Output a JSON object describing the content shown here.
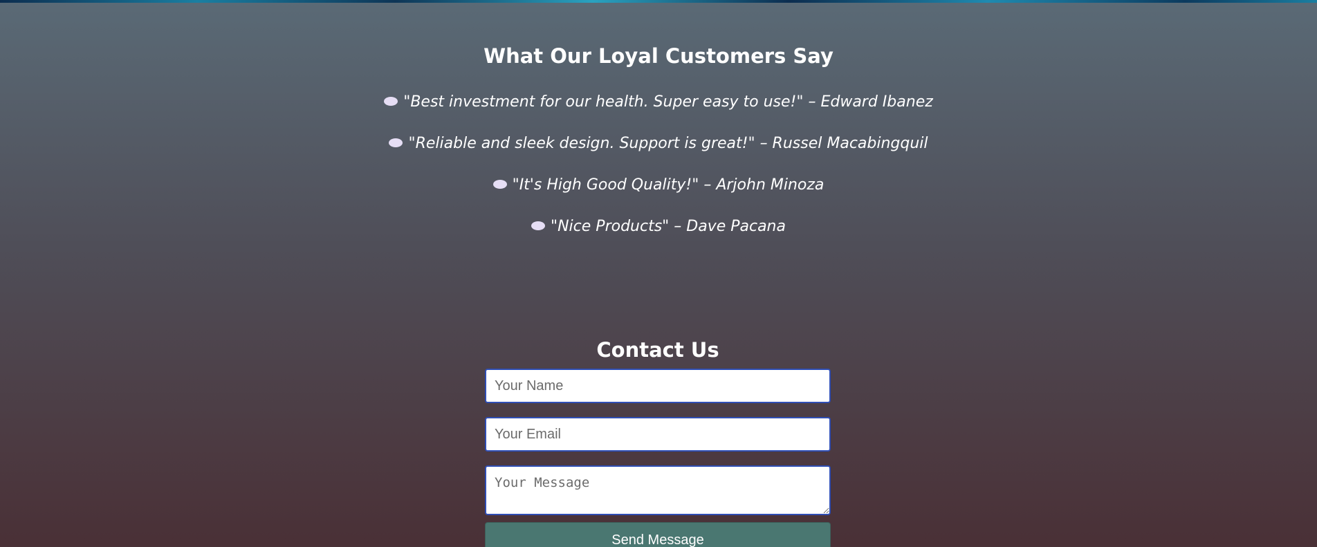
{
  "testimonials": {
    "title": "What Our Loyal Customers Say",
    "bubble_color": "#e6def5",
    "items": [
      {
        "text": "\"Best investment for our health. Super easy to use!\" – Edward Ibanez",
        "icon": "speech-bubble-icon"
      },
      {
        "text": "\"Reliable and sleek design. Support is great!\" – Russel Macabingquil",
        "icon": "speech-bubble-icon"
      },
      {
        "text": "\"It's High Good Quality!\" – Arjohn Minoza",
        "icon": "speech-bubble-icon"
      },
      {
        "text": "\"Nice Products\" – Dave Pacana",
        "icon": "speech-bubble-icon"
      }
    ]
  },
  "contact": {
    "title": "Contact Us",
    "name_placeholder": "Your Name",
    "email_placeholder": "Your Email",
    "message_placeholder": "Your Message",
    "send_label": "Send Message",
    "button_color": "#4a7771",
    "field_border_color": "#2f4eb5"
  }
}
